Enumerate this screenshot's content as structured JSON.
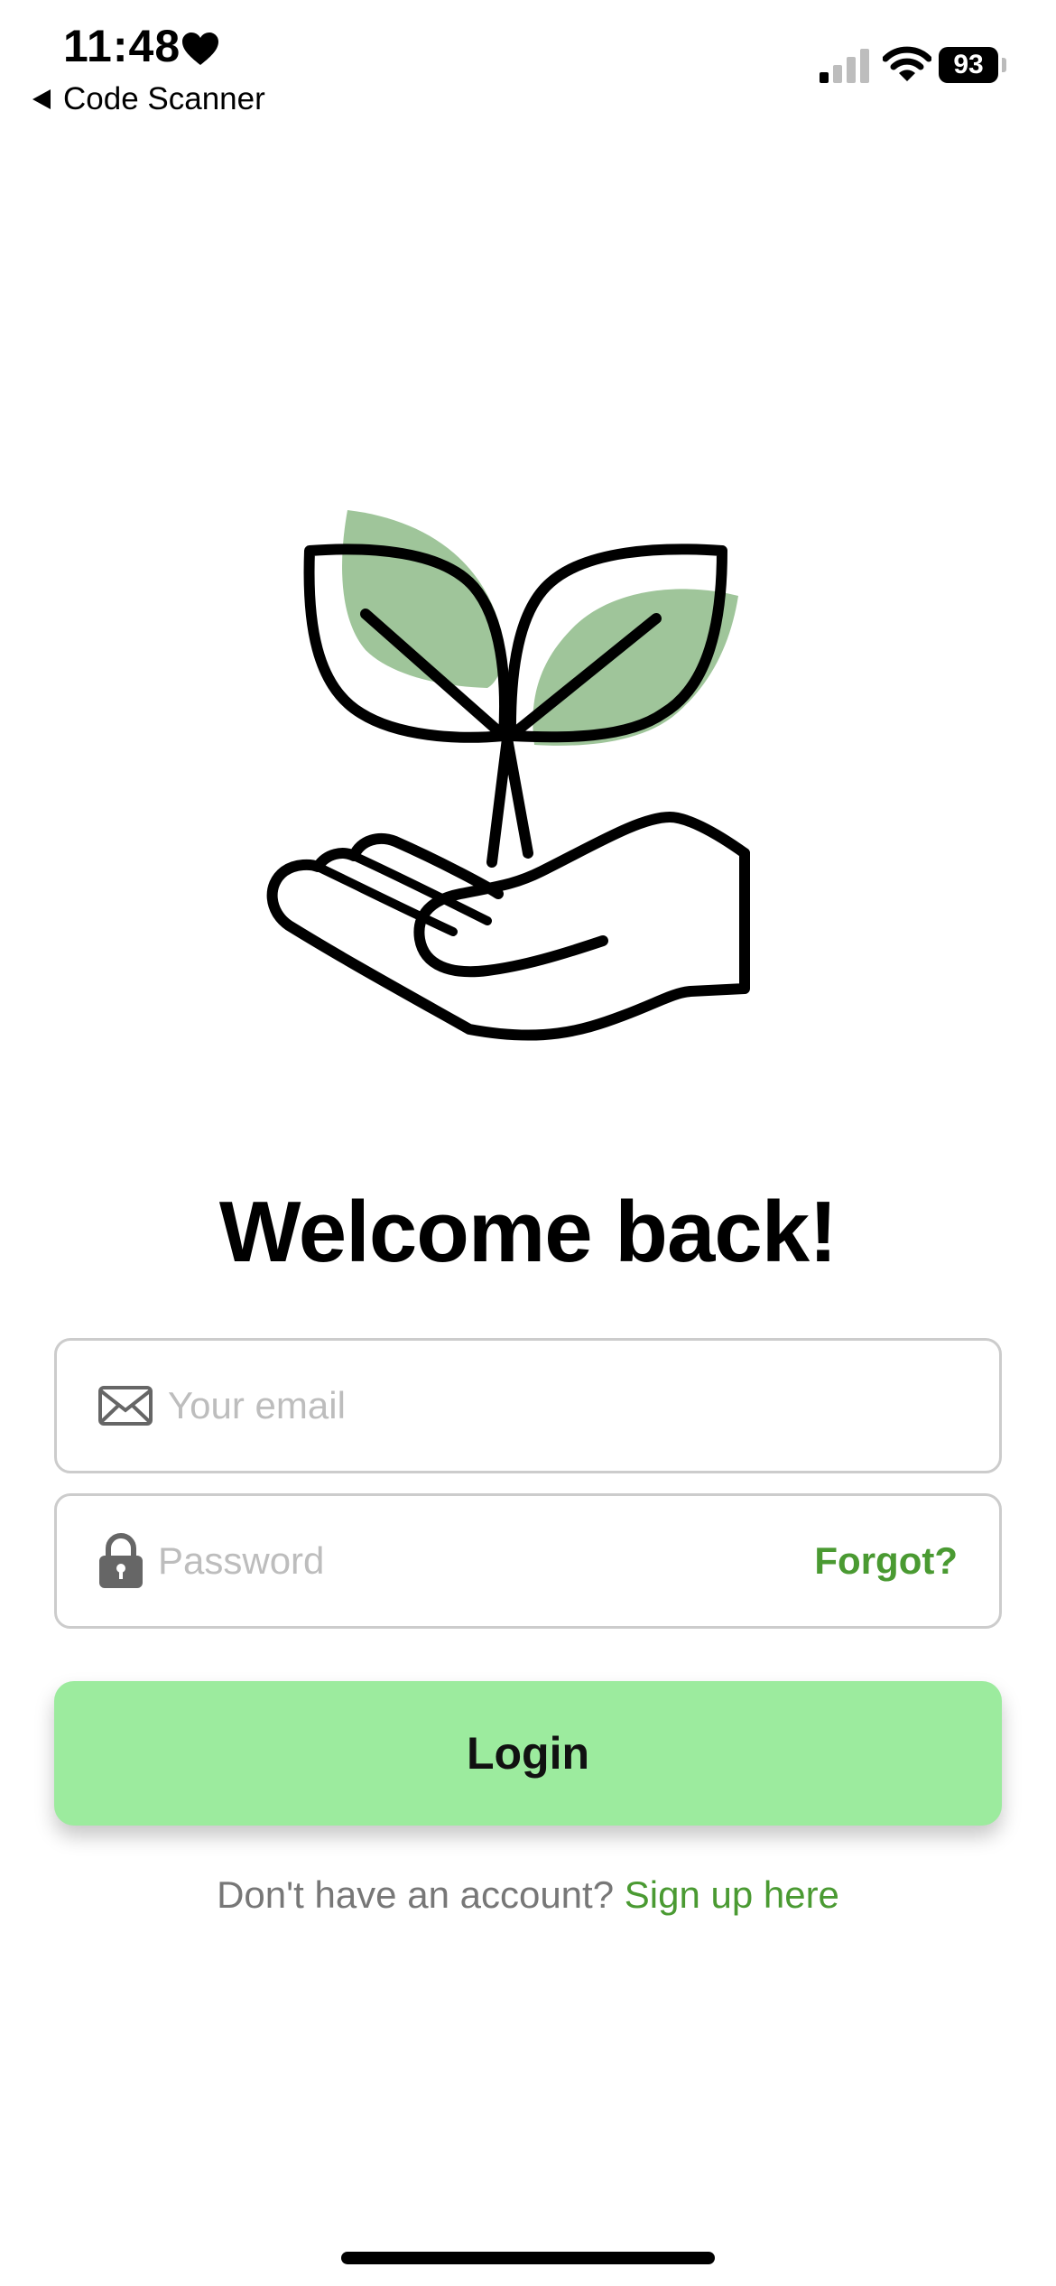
{
  "status_bar": {
    "time": "11:48",
    "back_app": "Code Scanner",
    "battery_level": "93",
    "heart_icon": "heart-icon",
    "signal_icon": "cellular-signal-icon",
    "wifi_icon": "wifi-icon"
  },
  "illustration": {
    "icon": "hand-holding-sprout-icon",
    "leaf_color": "#9fc59a"
  },
  "login": {
    "title": "Welcome back!",
    "email_placeholder": "Your email",
    "password_placeholder": "Password",
    "forgot_label": "Forgot?",
    "button_label": "Login",
    "signup_prompt": "Don't have an account?",
    "signup_link": "Sign up here"
  },
  "colors": {
    "accent_green": "#4a9a32",
    "button_green": "#9ceb9e",
    "border_gray": "#cccccc"
  }
}
